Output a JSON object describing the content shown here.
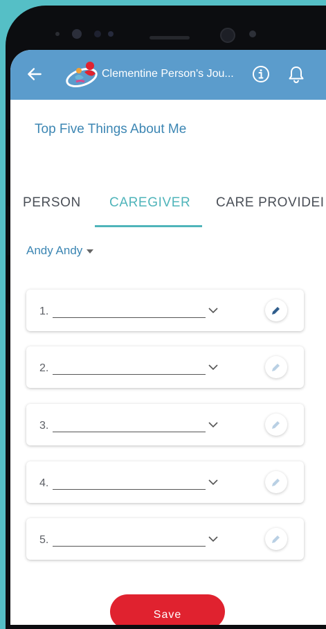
{
  "appbar": {
    "title": "Clementine Person's Jou..."
  },
  "page": {
    "title": "Top Five Things About Me"
  },
  "tabs": [
    {
      "label": "PERSON",
      "active": false
    },
    {
      "label": "CAREGIVER",
      "active": true
    },
    {
      "label": "CARE PROVIDEI",
      "active": false
    }
  ],
  "selector": {
    "value": "Andy Andy"
  },
  "items": [
    {
      "number": "1.",
      "edit_enabled": true
    },
    {
      "number": "2.",
      "edit_enabled": false
    },
    {
      "number": "3.",
      "edit_enabled": false
    },
    {
      "number": "4.",
      "edit_enabled": false
    },
    {
      "number": "5.",
      "edit_enabled": false
    }
  ],
  "actions": {
    "save_label": "Save"
  },
  "colors": {
    "background": "#55bfc6",
    "appbar": "#5b9ccc",
    "title_blue": "#3c86b3",
    "tab_active": "#4fb4ba",
    "save_button": "#e0222f"
  },
  "icons": {
    "back": "arrow-left-icon",
    "logo": "app-logo",
    "info": "info-icon",
    "bell": "bell-icon",
    "chevron": "chevron-down-icon",
    "edit": "pencil-icon",
    "caret": "caret-down-icon"
  }
}
